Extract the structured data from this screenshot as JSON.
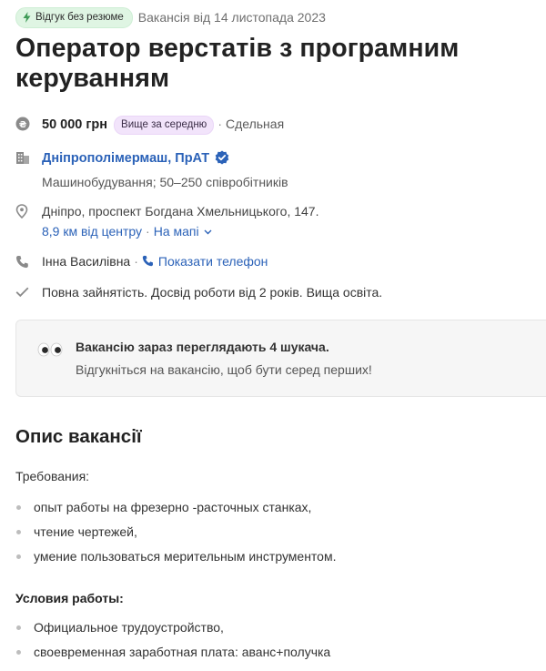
{
  "header": {
    "quick_apply_badge": "Відгук без резюме",
    "posted_date": "Вакансія від 14 листопада 2023",
    "title": "Оператор верстатів з програмним керуванням"
  },
  "salary": {
    "amount": "50 000 грн",
    "level_badge": "Вище за середню",
    "separator": "·",
    "pay_type": "Сдельная"
  },
  "company": {
    "name": "Дніпрополімермаш, ПрАТ",
    "details": "Машинобудування; 50–250 співробітників",
    "verified_icon": "check-badge-icon"
  },
  "location": {
    "address": "Дніпро, проспект Богдана Хмельницького, 147.",
    "distance": "8,9 км від центру",
    "separator": "·",
    "map_link": "На мапі"
  },
  "contact": {
    "person": "Інна Василівна",
    "separator": "·",
    "show_phone": "Показати телефон"
  },
  "requirements": {
    "summary": "Повна зайнятість. Досвід роботи від 2 років. Вища освіта."
  },
  "notice": {
    "headline": "Вакансію зараз переглядають 4 шукача.",
    "text": "Відгукніться на вакансію, щоб бути серед перших!"
  },
  "description": {
    "heading": "Опис вакансії",
    "requirements_label": "Требования:",
    "requirements": [
      "опыт работы на фрезерно -расточных станках,",
      "чтение чертежей,",
      "умение пользоваться мерительным инструментом."
    ],
    "conditions_label": "Условия работы:",
    "conditions": [
      "Официальное трудоустройство,",
      "своевременная заработная плата: аванс+получка"
    ]
  },
  "colors": {
    "link": "#2b62b8",
    "green_badge": "#dff5e3",
    "purple_badge": "#f2e4fb",
    "notice_bg": "#f6f6f6"
  }
}
